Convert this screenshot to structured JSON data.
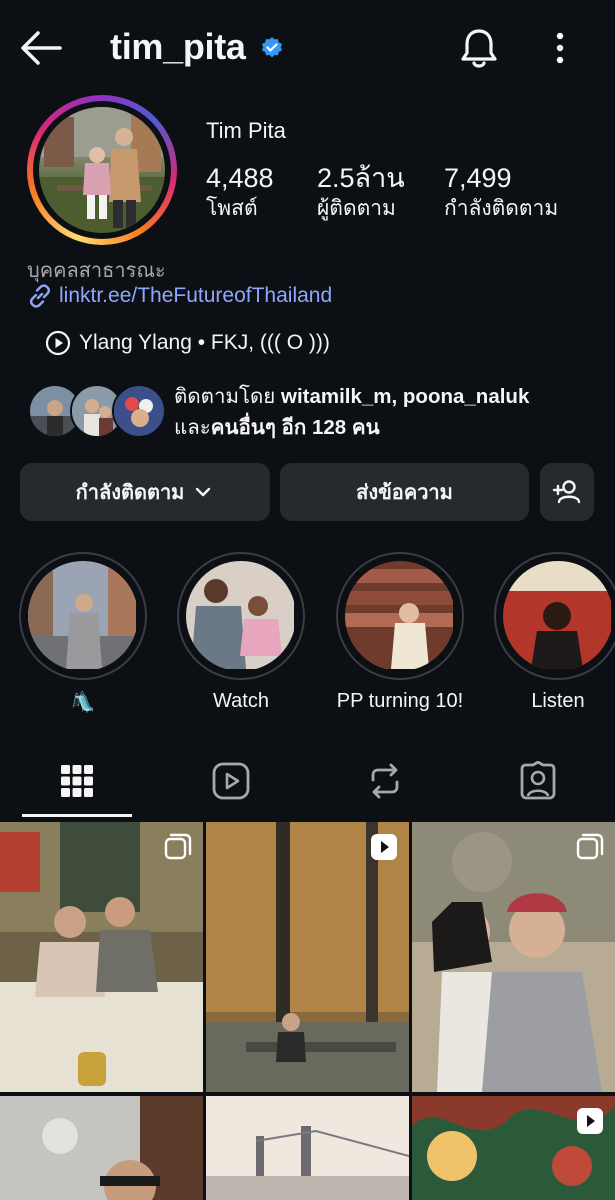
{
  "header": {
    "username": "tim_pita",
    "verified": true
  },
  "profile": {
    "full_name": "Tim Pita",
    "stats": [
      {
        "value": "4,488",
        "label": "โพสต์"
      },
      {
        "value": "2.5ล้าน",
        "label": "ผู้ติดตาม"
      },
      {
        "value": "7,499",
        "label": "กำลังติดตาม"
      }
    ],
    "category": "บุคคลสาธารณะ",
    "link": "linktr.ee/TheFutureofThailand",
    "music": "Ylang Ylang • FKJ, ((( O )))"
  },
  "followed_by": {
    "prefix": "ติดตามโดย ",
    "names": "witamilk_m, poona_naluk",
    "and": "และ",
    "others": "คนอื่นๆ อีก 128 คน"
  },
  "buttons": {
    "following": "กำลังติดตาม",
    "message": "ส่งข้อความ"
  },
  "highlights": [
    {
      "label": "🛝"
    },
    {
      "label": "Watch"
    },
    {
      "label": "PP turning 10!"
    },
    {
      "label": "Listen"
    }
  ],
  "tabs": [
    "grid",
    "reels",
    "reposts",
    "tagged"
  ],
  "icons": {
    "back": "arrow-left-icon",
    "bell": "bell-icon",
    "more": "more-vertical-icon",
    "verified": "verified-badge-icon",
    "link": "link-icon",
    "music": "play-circle-icon",
    "add_person": "add-person-icon"
  },
  "colors": {
    "background": "#0c1014",
    "button": "#262a2f",
    "link": "#8fa6ff",
    "verified": "#3897f0",
    "secondary_text": "#a8a8a8"
  }
}
